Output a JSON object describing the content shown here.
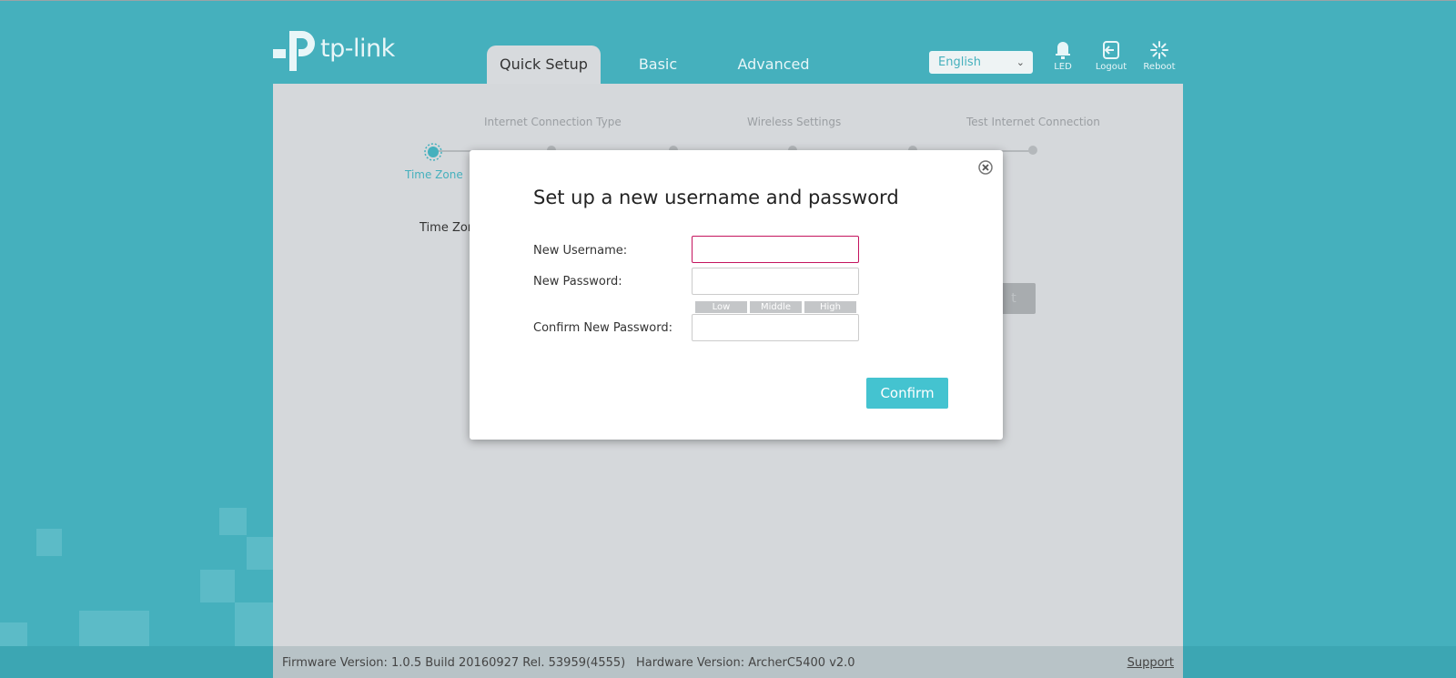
{
  "brand": {
    "logo_text": "tp-link"
  },
  "nav": {
    "tabs": [
      {
        "label": "Quick Setup",
        "active": true
      },
      {
        "label": "Basic",
        "active": false
      },
      {
        "label": "Advanced",
        "active": false
      }
    ]
  },
  "header": {
    "language": {
      "selected": "English"
    },
    "icons": [
      {
        "name": "led-icon",
        "label": "LED"
      },
      {
        "name": "logout-icon",
        "label": "Logout"
      },
      {
        "name": "reboot-icon",
        "label": "Reboot"
      }
    ]
  },
  "wizard": {
    "steps": [
      {
        "label": "Time Zone",
        "active": true
      },
      {
        "label": "Internet Connection Type",
        "active": false
      },
      {
        "label": "Wireless Settings",
        "active": false
      },
      {
        "label": "Test Internet Connection",
        "active": false
      }
    ],
    "time_zone_label": "Time Zon",
    "next_label": "t"
  },
  "modal": {
    "title": "Set up a new username and password",
    "fields": {
      "username_label": "New Username:",
      "password_label": "New Password:",
      "confirm_label": "Confirm New Password:",
      "username_value": "",
      "password_value": "",
      "confirm_value": ""
    },
    "strength": {
      "low": "Low",
      "middle": "Middle",
      "high": "High"
    },
    "confirm_button": "Confirm"
  },
  "footer": {
    "firmware": "Firmware Version: 1.0.5 Build 20160927 Rel. 53959(4555)",
    "hardware": "Hardware Version: ArcherC5400 v2.0",
    "support": "Support"
  },
  "colors": {
    "background": "#45b0bd",
    "accent": "#44c3d0",
    "content": "#d5d8db",
    "focus_border": "#c4145e"
  }
}
